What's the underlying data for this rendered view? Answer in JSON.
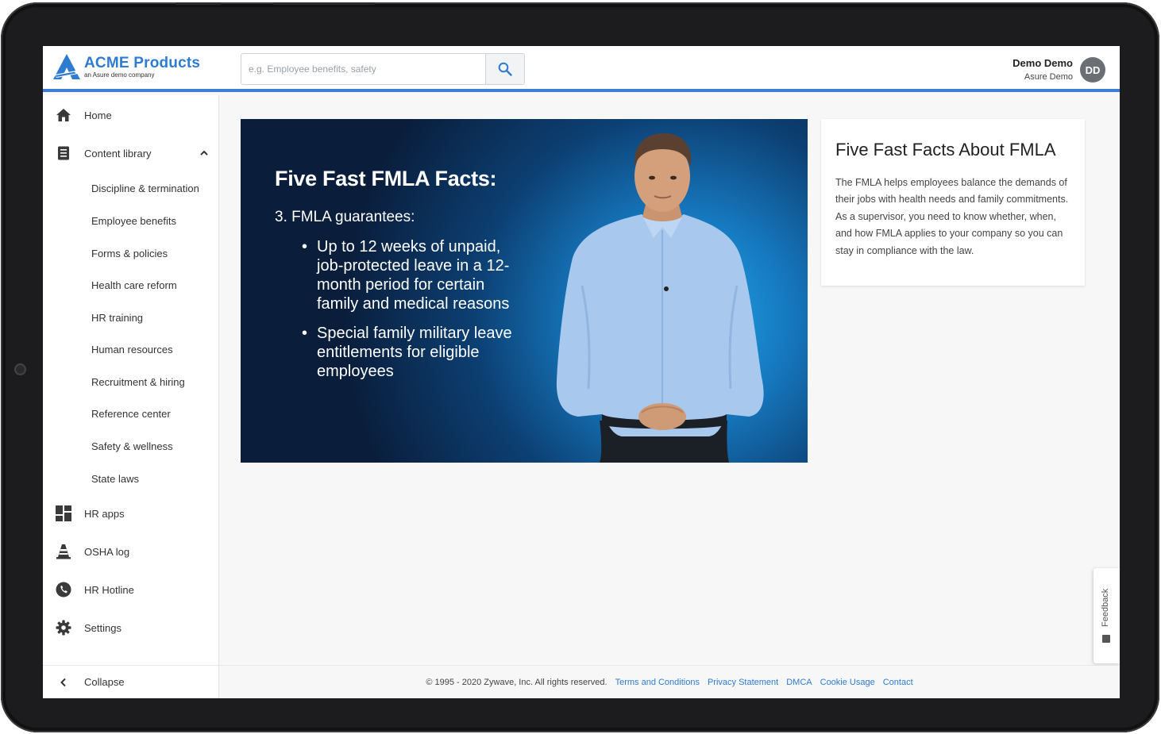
{
  "header": {
    "logo_title": "ACME Products",
    "logo_subtitle": "an Asure demo company",
    "search_placeholder": "e.g. Employee benefits, safety",
    "search_value": "",
    "user_name": "Demo Demo",
    "user_org": "Asure Demo",
    "avatar_initials": "DD"
  },
  "sidebar": {
    "items": [
      {
        "label": "Home",
        "icon": "home-icon"
      },
      {
        "label": "Content library",
        "icon": "document-list-icon",
        "expanded": true
      },
      {
        "label": "HR apps",
        "icon": "apps-grid-icon"
      },
      {
        "label": "OSHA log",
        "icon": "traffic-cone-icon"
      },
      {
        "label": "HR Hotline",
        "icon": "phone-icon"
      },
      {
        "label": "Settings",
        "icon": "gear-icon"
      }
    ],
    "sub_items": [
      "Discipline & termination",
      "Employee benefits",
      "Forms & policies",
      "Health care reform",
      "HR training",
      "Human resources",
      "Recruitment & hiring",
      "Reference center",
      "Safety & wellness",
      "State laws"
    ],
    "collapse_label": "Collapse"
  },
  "video": {
    "slide_title": "Five Fast FMLA Facts:",
    "slide_point": "3. FMLA guarantees:",
    "bullets": [
      "Up to 12 weeks of unpaid, job-protected leave in a 12-month period for certain family and medical reasons",
      "Special family military leave entitlements for eligible employees"
    ]
  },
  "fact_card": {
    "title": "Five Fast Facts About FMLA",
    "body": "The FMLA helps employees balance the demands of their jobs with health needs and family commitments. As a supervisor, you need to know whether, when, and how FMLA applies to your company so you can stay in compliance with the law."
  },
  "feedback_label": "Feedback",
  "footer": {
    "copyright": "© 1995 - 2020 Zywave, Inc. All rights reserved.",
    "links": [
      "Terms and Conditions",
      "Privacy Statement",
      "DMCA",
      "Cookie Usage",
      "Contact"
    ]
  },
  "colors": {
    "brand_blue": "#2e7bd0",
    "header_accent": "#3d7fd8",
    "avatar_gray": "#6b6e73"
  }
}
